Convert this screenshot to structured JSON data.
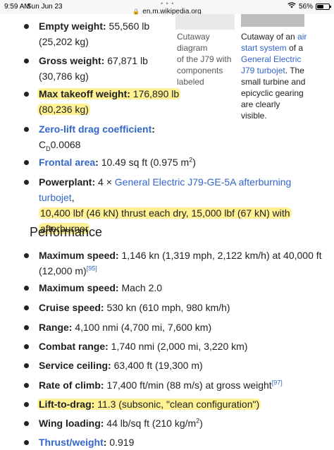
{
  "status": {
    "time": "9:59 AM",
    "date": "Sun Jun 23",
    "battery_text": "56%",
    "battery_level": 0.56
  },
  "url": "en.m.wikipedia.org",
  "captions": {
    "left": [
      "Cutaway diagram",
      "of the J79 with",
      "components",
      "labeled"
    ],
    "right_prefix": "Cutaway of an ",
    "right_link1": "air",
    "right_link1b": "start system",
    "right_mid": " of a",
    "right_link2": "General Electric",
    "right_link3": "J79 turbojet",
    "right_after": ".",
    "right_rest": [
      "The",
      "small turbine and",
      "epicyclic gearing",
      "are clearly",
      "visible."
    ]
  },
  "specs": {
    "empty_weight_label": "Empty weight:",
    "empty_weight_value_1": " 55,560 lb",
    "empty_weight_value_2": "(25,202 kg)",
    "gross_weight_label": "Gross weight:",
    "gross_weight_value_1": " 67,871 lb",
    "gross_weight_value_2": "(30,786 kg)",
    "mtow_label": "Max takeoff weight:",
    "mtow_value_1": " 176,890 lb",
    "mtow_value_2": "(80,236 kg)",
    "zero_lift_label": "Zero-lift drag coefficient",
    "zero_lift_colon": ":",
    "cd_c": "C",
    "cd_sub": "D",
    "cd_value": "0.0068",
    "frontal_label": "Frontal area",
    "frontal_colon": ":",
    "frontal_value": " 10.49 sq ft (0.975 m",
    "frontal_sup": "2",
    "frontal_end": ")",
    "powerplant_label": "Powerplant:",
    "powerplant_prefix": " 4 × ",
    "powerplant_link": "General Electric J79-GE-5A afterburning turbojet",
    "powerplant_suffix": ",",
    "powerplant_line2": "10,400 lbf (46 kN) thrust each dry, 15,000 lbf (67 kN) with",
    "powerplant_line3": "afterburner"
  },
  "performance": {
    "heading": "Performance",
    "max_speed_label": "Maximum speed:",
    "max_speed_value_1": " 1,146 kn (1,319 mph, 2,122 km/h) at 40,000 ft",
    "max_speed_value_2": "(12,000 m)",
    "max_speed_ref": "[95]",
    "max_speed2_label": "Maximum speed:",
    "max_speed2_value": " Mach 2.0",
    "cruise_label": "Cruise speed:",
    "cruise_value": " 530 kn (610 mph, 980 km/h)",
    "range_label": "Range:",
    "range_value": " 4,100 nmi (4,700 mi, 7,600 km)",
    "combat_label": "Combat range:",
    "combat_value": " 1,740 nmi (2,000 mi, 3,220 km)",
    "ceiling_label": "Service ceiling:",
    "ceiling_value": " 63,400 ft (19,300 m)",
    "climb_label": "Rate of climb:",
    "climb_value": " 17,400 ft/min (88 m/s) at gross weight",
    "climb_ref": "[97]",
    "ltd_label": "Lift-to-drag:",
    "ltd_value": " 11.3 (subsonic, \"clean configuration\")",
    "wing_label": "Wing loading:",
    "wing_value": " 44 lb/sq ft (210 kg/m",
    "wing_sup": "2",
    "wing_end": ")",
    "tw_label": "Thrust/weight",
    "tw_colon": ":",
    "tw_value": " 0.919"
  }
}
